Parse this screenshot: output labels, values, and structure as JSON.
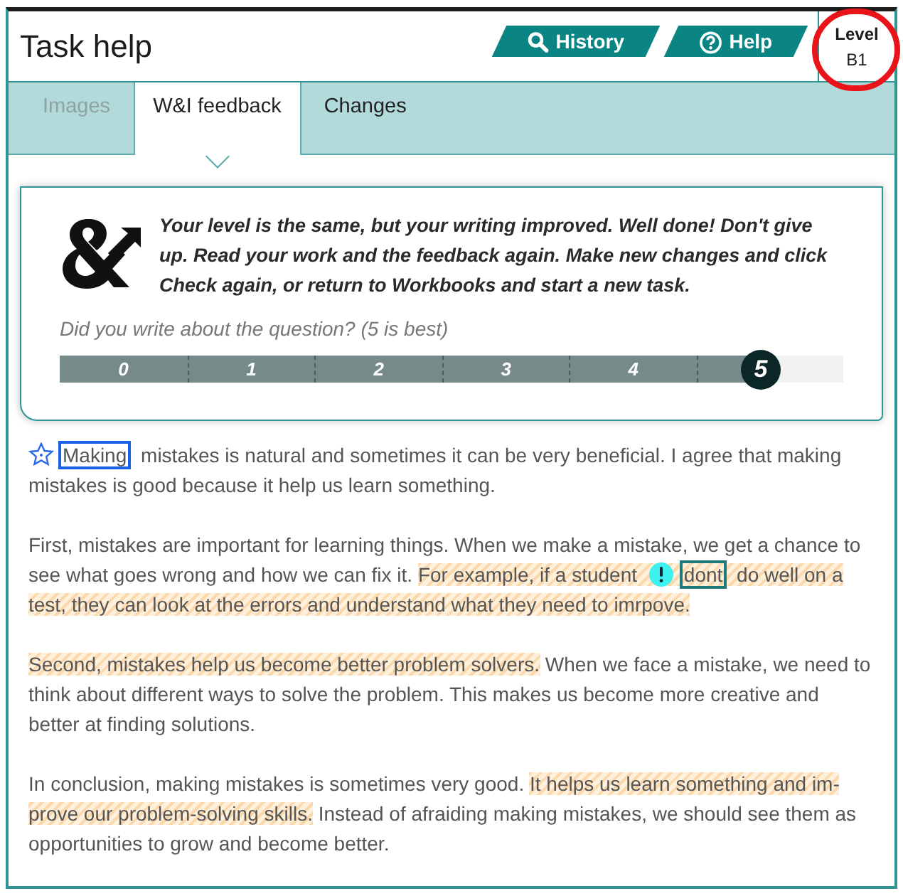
{
  "header": {
    "title": "Task help",
    "buttons": [
      {
        "label": "History",
        "kind": "search"
      },
      {
        "label": "Help",
        "kind": "help"
      }
    ],
    "level": {
      "label": "Level",
      "value": "B1"
    }
  },
  "tabs": [
    {
      "label": "Images",
      "selected": false,
      "disabled": true
    },
    {
      "label": "W&I feedback",
      "selected": true,
      "disabled": false
    },
    {
      "label": "Changes",
      "selected": false,
      "disabled": false
    }
  ],
  "feedback": {
    "message": "Your level is the same, but your writing improved. Well done! Don't give up. Read your work and the feedback again. Make new changes and click Check again, or return to Workbooks and start a new task.",
    "question": "Did you write about the question? (5 is best)",
    "scale": {
      "level": 0.905,
      "points": [
        {
          "label": "0",
          "selected": false
        },
        {
          "label": "1",
          "selected": false
        },
        {
          "label": "2",
          "selected": false
        },
        {
          "label": "3",
          "selected": false
        },
        {
          "label": "4",
          "selected": false
        },
        {
          "label": "5",
          "selected": true
        }
      ]
    }
  },
  "essay": [
    {
      "segments": [
        {
          "kind": "star-flag",
          "text": "Making"
        },
        {
          "kind": "text",
          "text": " mistakes is natural and sometimes it can be very beneficial. I agree that making mistakes is good because it help us learn something."
        }
      ]
    },
    {
      "segments": [
        {
          "kind": "text",
          "text": "First, mistakes are important for learning things. When we make a mistake, we get a chance to see what goes wrong and how we can fix it. "
        },
        {
          "kind": "highlight",
          "segments": [
            {
              "kind": "text",
              "text": "For example, if a student "
            },
            {
              "kind": "alert-flag",
              "text": "dont"
            },
            {
              "kind": "text",
              "text": " do well on a test, they can look at the errors and understand what they need to imrpove."
            }
          ]
        }
      ]
    },
    {
      "segments": [
        {
          "kind": "highlight",
          "segments": [
            {
              "kind": "text",
              "text": "Second, mistakes help us become better problem solvers."
            }
          ]
        },
        {
          "kind": "text",
          "text": " When we face a mistake, we need to think about different ways to solve the problem. This makes us become more creative and better at finding solutions."
        }
      ]
    },
    {
      "segments": [
        {
          "kind": "text",
          "text": "In conclusion, making mistakes is sometimes very good. "
        },
        {
          "kind": "highlight",
          "segments": [
            {
              "kind": "text",
              "text": "It helps us learn something and im-prove our problem-solving skills."
            }
          ]
        },
        {
          "kind": "text",
          "text": " Instead of afraiding making mistakes, we should see them as opportunities to grow and become better."
        }
      ]
    }
  ]
}
